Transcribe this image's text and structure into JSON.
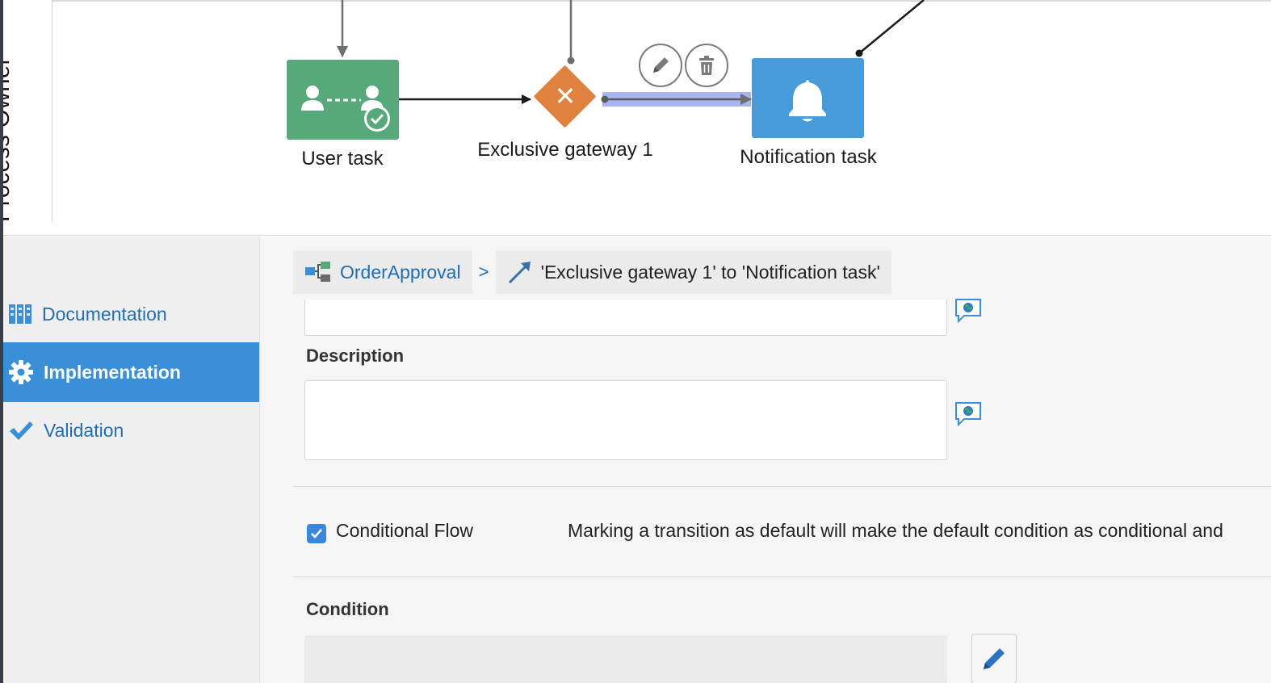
{
  "lane": {
    "title": "Process Owner"
  },
  "diagram": {
    "nodes": [
      {
        "id": "user_task",
        "label": "User task",
        "type": "user-task",
        "color": "#57a97b"
      },
      {
        "id": "exclusive_gateway_1",
        "label": "Exclusive gateway 1",
        "type": "exclusive-gateway",
        "color": "#e0823f"
      },
      {
        "id": "notification_task",
        "label": "Notification task",
        "type": "notification-task",
        "color": "#479bd8"
      }
    ],
    "selected_flow": {
      "from": "Exclusive gateway 1",
      "to": "Notification task",
      "highlight_color": "#aab4f0"
    },
    "flow_actions": [
      {
        "name": "edit",
        "icon": "pencil-icon"
      },
      {
        "name": "delete",
        "icon": "trash-icon"
      }
    ]
  },
  "sidebar": {
    "items": [
      {
        "label": "Documentation",
        "icon": "documentation-icon",
        "active": false
      },
      {
        "label": "Implementation",
        "icon": "gear-icon",
        "active": true
      },
      {
        "label": "Validation",
        "icon": "checkmark-icon",
        "active": false
      }
    ],
    "active_color": "#3b8fd8"
  },
  "breadcrumb": {
    "process": "OrderApproval",
    "separator": ">",
    "current": "'Exclusive gateway 1' to 'Notification task'"
  },
  "form": {
    "name_value": "",
    "description_label": "Description",
    "description_value": "",
    "conditional_flow": {
      "label": "Conditional Flow",
      "checked": true,
      "help": "Marking a transition as default will make the default condition as conditional and"
    },
    "condition_label": "Condition",
    "condition_value": ""
  }
}
